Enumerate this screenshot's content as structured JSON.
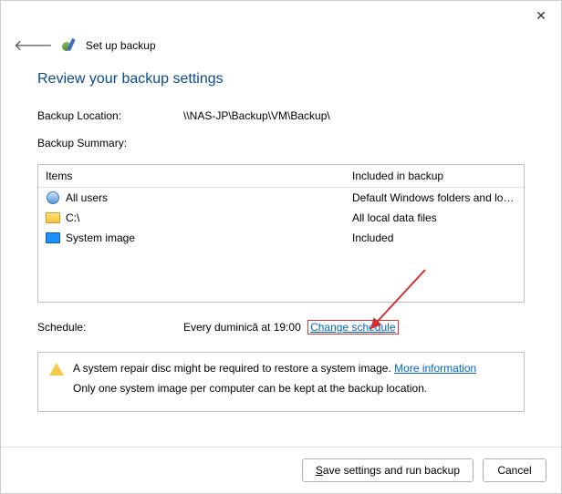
{
  "window": {
    "title": "Set up backup",
    "close": "✕"
  },
  "page_heading": "Review your backup settings",
  "location": {
    "label": "Backup Location:",
    "value": "\\\\NAS-JP\\Backup\\VM\\Backup\\"
  },
  "summary_label": "Backup Summary:",
  "summary_headers": {
    "items": "Items",
    "included": "Included in backup"
  },
  "summary_rows": [
    {
      "icon": "users-icon",
      "name": "All users",
      "included": "Default Windows folders and lo…"
    },
    {
      "icon": "folder-icon",
      "name": "C:\\",
      "included": "All local data files"
    },
    {
      "icon": "monitor-icon",
      "name": "System image",
      "included": "Included"
    }
  ],
  "schedule": {
    "label": "Schedule:",
    "value": "Every duminică at 19:00",
    "change_link": "Change schedule"
  },
  "info": {
    "line1_prefix": "A system repair disc might be required to restore a system image. ",
    "more_link": "More information",
    "line2": "Only one system image per computer can be kept at the backup location."
  },
  "buttons": {
    "save": "ave settings and run backup",
    "save_mnemonic": "S",
    "cancel": "Cancel"
  }
}
